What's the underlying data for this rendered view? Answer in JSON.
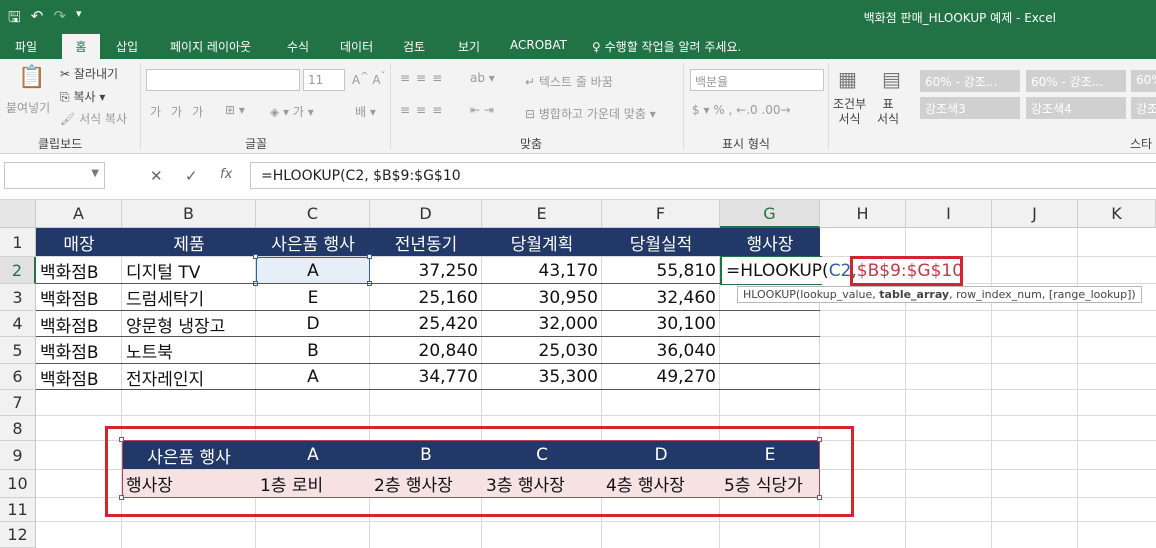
{
  "window": {
    "title": "백화점 판매_HLOOKUP 예제 - Excel"
  },
  "tabs": [
    "파일",
    "홈",
    "삽입",
    "페이지 레이아웃",
    "수식",
    "데이터",
    "검토",
    "보기",
    "ACROBAT"
  ],
  "tell_me": "수행할 작업을 알려 주세요.",
  "ribbon": {
    "paste": "붙여넣기",
    "cut": "잘라내기",
    "copy": "복사",
    "format_painter": "서식 복사",
    "font_size": "11",
    "wrap_text": "텍스트 줄 바꿈",
    "merge_center": "병합하고 가운데 맞춤",
    "number_format": "백분율",
    "cond_format": [
      "조건부",
      "서식"
    ],
    "table_format": [
      "표",
      "서식"
    ],
    "styles": [
      "60% - 강조...",
      "60% - 강조...",
      "60%",
      "강조색3",
      "강조색4",
      "강조"
    ],
    "groups": {
      "clipboard": "클립보드",
      "font": "글꼴",
      "alignment": "맞춤",
      "number": "표시 형식",
      "styles": "스타"
    }
  },
  "formula_bar": {
    "formula": "=HLOOKUP(C2, $B$9:$G$10",
    "fx": "fx"
  },
  "columns": [
    "A",
    "B",
    "C",
    "D",
    "E",
    "F",
    "G",
    "H",
    "I",
    "J",
    "K"
  ],
  "rows": [
    "1",
    "2",
    "3",
    "4",
    "5",
    "6",
    "7",
    "8",
    "9",
    "10",
    "11",
    "12"
  ],
  "table": {
    "headers": [
      "매장",
      "제품",
      "사은품 행사",
      "전년동기",
      "당월계획",
      "당월실적",
      "행사장"
    ],
    "rows": [
      [
        "백화점B",
        "디지털 TV",
        "A",
        "37,250",
        "43,170",
        "55,810"
      ],
      [
        "백화점B",
        "드럼세탁기",
        "E",
        "25,160",
        "30,950",
        "32,460"
      ],
      [
        "백화점B",
        "양문형 냉장고",
        "D",
        "25,420",
        "32,000",
        "30,100"
      ],
      [
        "백화점B",
        "노트북",
        "B",
        "20,840",
        "25,030",
        "36,040"
      ],
      [
        "백화점B",
        "전자레인지",
        "A",
        "34,770",
        "35,300",
        "49,270"
      ]
    ]
  },
  "lookup": {
    "row9": [
      "사은품 행사",
      "A",
      "B",
      "C",
      "D",
      "E"
    ],
    "row10": [
      "행사장",
      "1층 로비",
      "2층 행사장",
      "3층 행사장",
      "4층 행사장",
      "5층 식당가"
    ]
  },
  "edit_cell": {
    "prefix": "=HLOOKUP(",
    "ref1": "C2",
    "ref2": "$B$9:$G$10"
  },
  "tooltip": {
    "a": "HLOOKUP(lookup_value, ",
    "b": "table_array",
    "c": ", row_index_num, [range_lookup])"
  },
  "colors": {
    "excel_green": "#217346",
    "header_navy": "#223868",
    "lookup_pink": "#f6e1e3",
    "highlight_red": "#d32430",
    "ref_blue": "#2f5fa8"
  }
}
